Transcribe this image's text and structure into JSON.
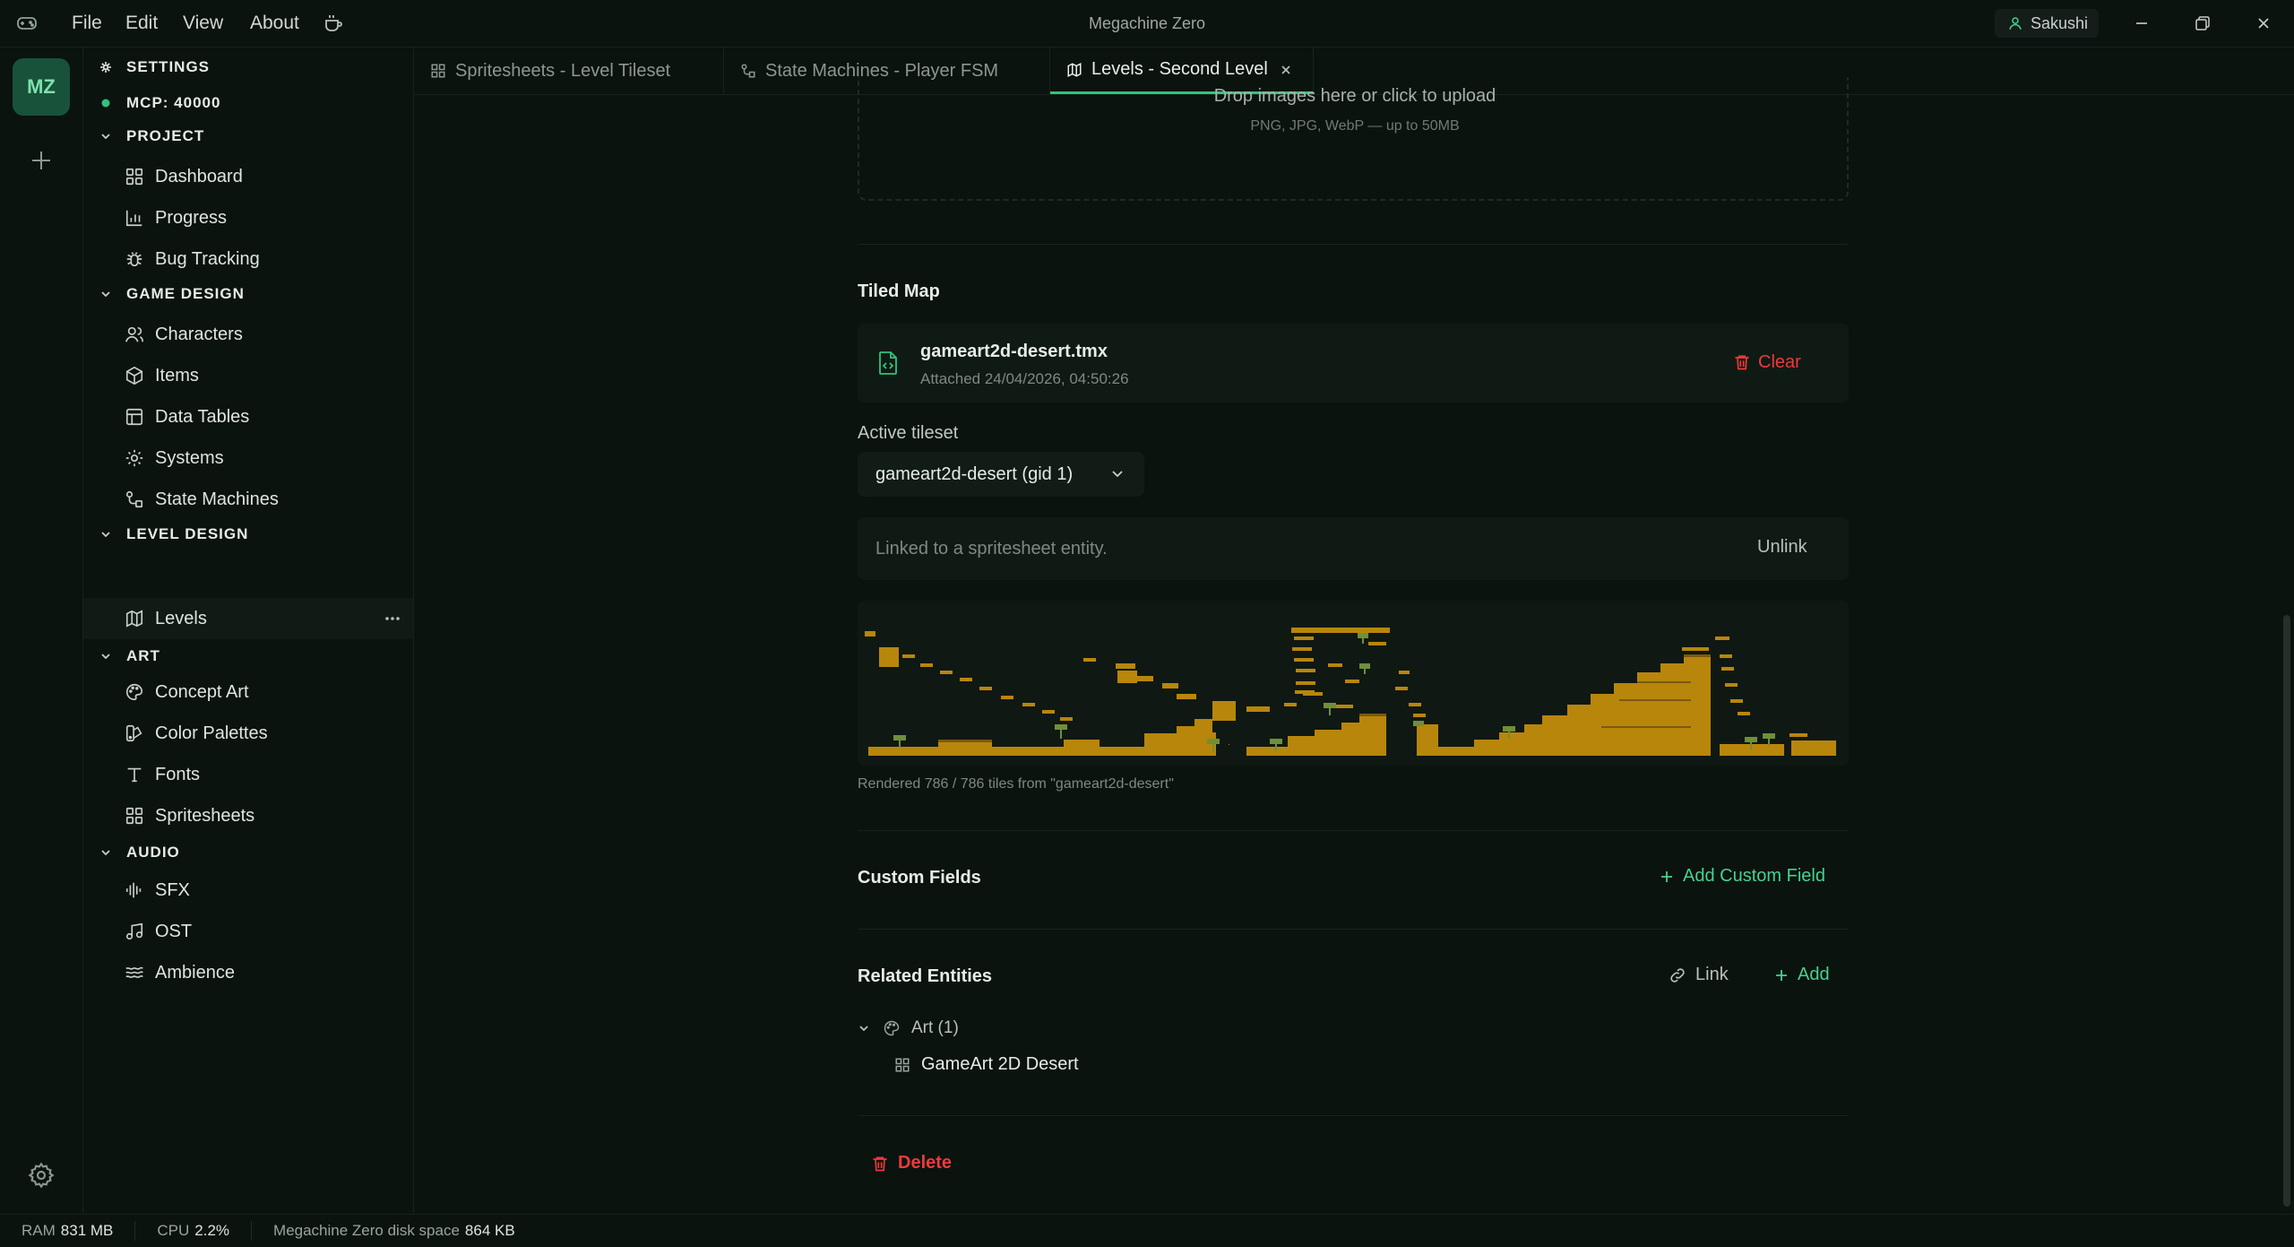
{
  "titlebar": {
    "menu": [
      "File",
      "Edit",
      "View",
      "About"
    ],
    "app_title": "Megachine Zero",
    "user": "Sakushi"
  },
  "activity": {
    "badge": "MZ"
  },
  "sidebar": {
    "settings": "SETTINGS",
    "mcp": "MCP: 40000",
    "sections": [
      {
        "title": "PROJECT",
        "items": [
          "Dashboard",
          "Progress",
          "Bug Tracking"
        ]
      },
      {
        "title": "GAME DESIGN",
        "items": [
          "Characters",
          "Items",
          "Data Tables",
          "Systems",
          "State Machines"
        ]
      },
      {
        "title": "LEVEL DESIGN",
        "items": [
          "Levels"
        ]
      },
      {
        "title": "ART",
        "items": [
          "Concept Art",
          "Color Palettes",
          "Fonts",
          "Spritesheets"
        ]
      },
      {
        "title": "AUDIO",
        "items": [
          "SFX",
          "OST",
          "Ambience"
        ]
      }
    ]
  },
  "tabs": [
    {
      "label": "Spritesheets - Level Tileset",
      "icon": "grid-icon"
    },
    {
      "label": "State Machines - Player FSM",
      "icon": "state-machine-icon"
    },
    {
      "label": "Levels - Second Level",
      "icon": "map-icon",
      "active": true
    }
  ],
  "upload": {
    "title": "Drop images here or click to upload",
    "hint": "PNG, JPG, WebP — up to 50MB"
  },
  "tiled_map": {
    "heading": "Tiled Map",
    "file_name": "gameart2d-desert.tmx",
    "attached": "Attached 24/04/2026, 04:50:26",
    "clear_label": "Clear",
    "active_tileset_label": "Active tileset",
    "tileset_selected": "gameart2d-desert (gid 1)",
    "linked_text": "Linked to a spritesheet entity.",
    "unlink_label": "Unlink",
    "render_status": "Rendered 786 / 786 tiles from \"gameart2d-desert\""
  },
  "custom_fields": {
    "heading": "Custom Fields",
    "add_label": "Add Custom Field"
  },
  "related": {
    "heading": "Related Entities",
    "link_label": "Link",
    "add_label": "Add",
    "group_label": "Art (1)",
    "entity_label": "GameArt 2D Desert"
  },
  "delete_label": "Delete",
  "status": {
    "ram_label": "RAM",
    "ram_value": "831 MB",
    "cpu_label": "CPU",
    "cpu_value": "2.2%",
    "disk_label": "Megachine Zero disk space",
    "disk_value": "864 KB"
  },
  "colors": {
    "accent": "#2fc47c",
    "danger": "#ee3a3a",
    "background": "#0b130f",
    "terrain": "#b8860b"
  }
}
